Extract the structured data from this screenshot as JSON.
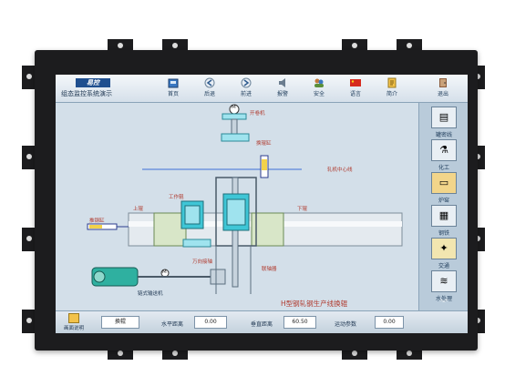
{
  "header": {
    "logo_text": "易控",
    "subtitle": "组态监控系统演示"
  },
  "toolbar": [
    {
      "label": "首页",
      "icon": "home-icon"
    },
    {
      "label": "后退",
      "icon": "back-icon"
    },
    {
      "label": "前进",
      "icon": "forward-icon"
    },
    {
      "label": "报警",
      "icon": "alarm-icon"
    },
    {
      "label": "安全",
      "icon": "security-icon"
    },
    {
      "label": "语言",
      "icon": "language-flag-icon"
    },
    {
      "label": "简介",
      "icon": "info-icon"
    },
    {
      "label": "退出",
      "icon": "exit-icon"
    }
  ],
  "sidebar": [
    {
      "label": "罐密线"
    },
    {
      "label": "化工"
    },
    {
      "label": "炉窑"
    },
    {
      "label": "钢铁"
    },
    {
      "label": "交通"
    },
    {
      "label": "水处理"
    }
  ],
  "diagram": {
    "labels": {
      "motor": "M",
      "motor2": "M",
      "roll_changer": "开卷机",
      "hydraulic_cyl": "换辊缸",
      "center_line": "轧机中心线",
      "push_cyl": "推钢缸",
      "upper_roll": "上辊",
      "work_roll": "工作辊",
      "lower_roll": "下辊",
      "drive_shaft": "万向接轴",
      "coupling": "联轴器",
      "conveyor": "链式输送机"
    },
    "caption": "H型钢轧钢生产线换辊"
  },
  "status": {
    "screen_btn_label": "画面说明",
    "mode_value": "换辊",
    "horizontal_label": "水平距离",
    "horizontal_value": "0.00",
    "vertical_label": "垂直距离",
    "vertical_value": "60.50",
    "motion_label": "运动参数",
    "motion_value": "0.00"
  },
  "colors": {
    "accent": "#1f4f8f",
    "equipment": "#3fc6d6",
    "alarm_text": "#b03a2e",
    "bezel": "#1c1c1e"
  }
}
